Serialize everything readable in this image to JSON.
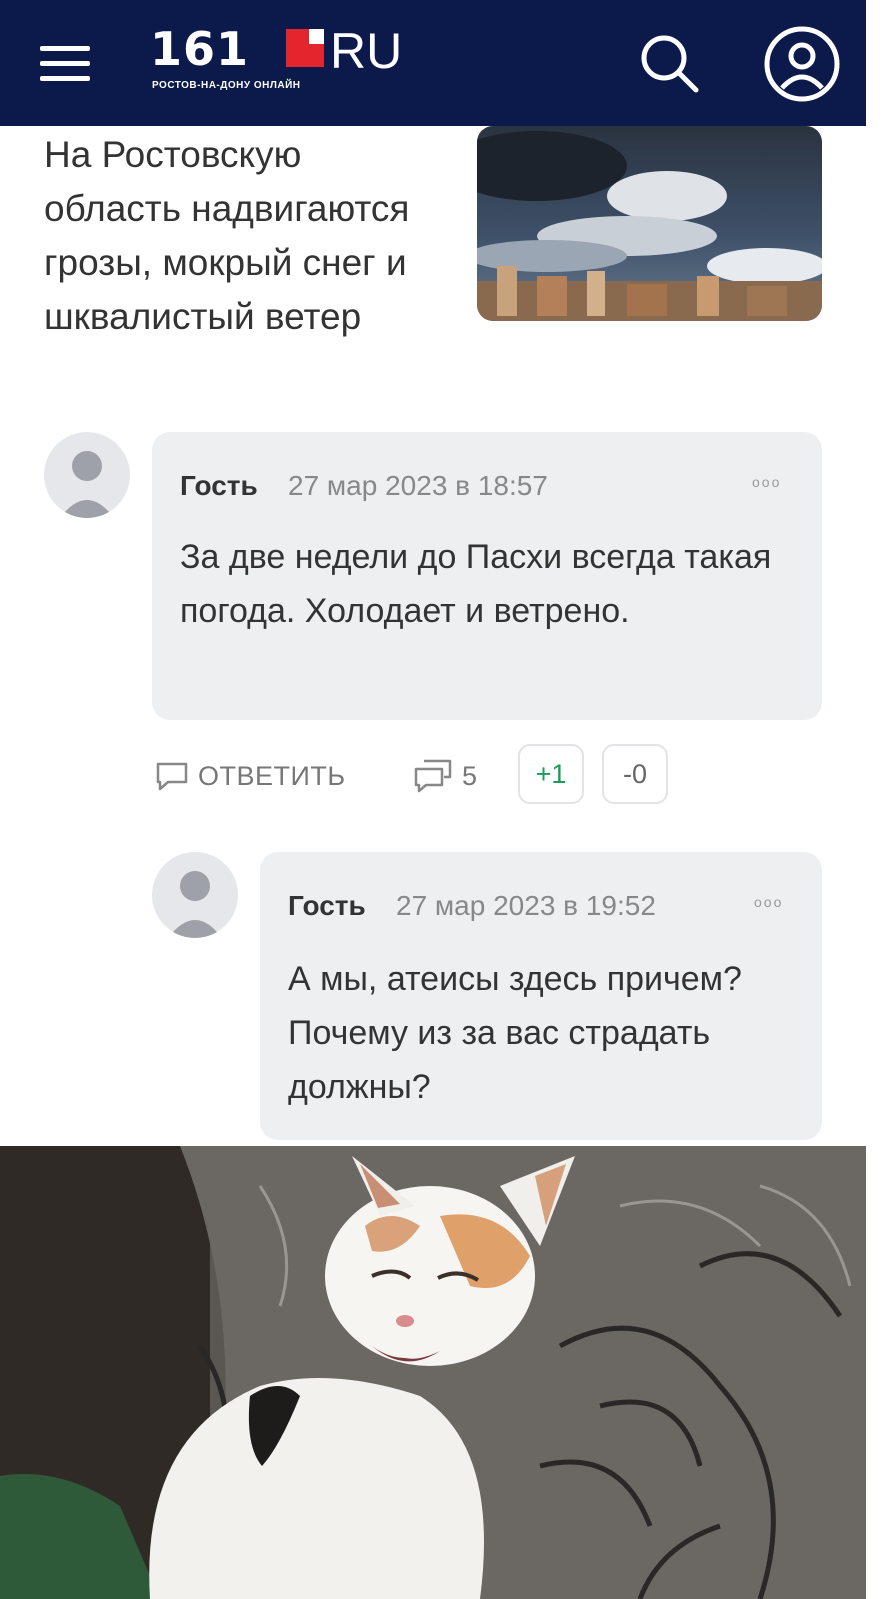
{
  "header": {
    "logo_number": "161",
    "logo_suffix": "RU",
    "logo_subtitle": "РОСТОВ-НА-ДОНУ ОНЛАЙН",
    "menu_icon": "hamburger-icon",
    "search_icon": "search-icon",
    "user_icon": "user-icon",
    "colors": {
      "bar": "#0b1a4a",
      "flag": "#e3262d"
    }
  },
  "teaser": {
    "title": "На Ростовскую область надвигаются грозы, мокрый снег и шквалистый ветер",
    "image": "storm-clouds-over-city"
  },
  "comments": [
    {
      "author": "Гость",
      "date": "27 мар 2023 в 18:57",
      "text": "За две недели до Пасхи всегда такая погода. Холодает и ветрено.",
      "more": "ooo",
      "actions": {
        "reply_label": "ОТВЕТИТЬ",
        "replies_count": "5",
        "upvote": "+1",
        "downvote": "-0"
      }
    },
    {
      "author": "Гость",
      "date": "27 мар 2023 в 19:52",
      "text": "А мы, атеисы здесь причем? Почему из за вас страдать должны?",
      "more": "ooo"
    }
  ],
  "attachment": {
    "image": "cat-photo"
  }
}
